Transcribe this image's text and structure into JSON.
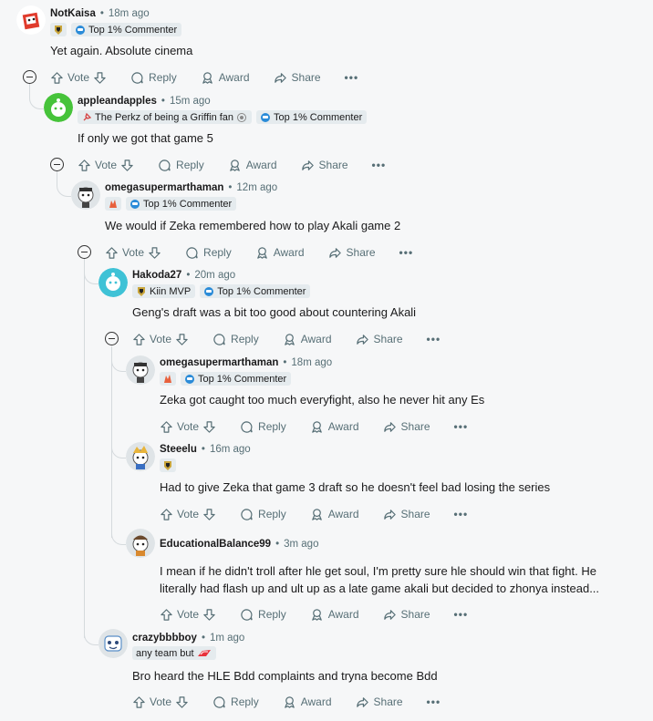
{
  "actions": {
    "vote": "Vote",
    "reply": "Reply",
    "award": "Award",
    "share": "Share",
    "more": "•••"
  },
  "comments": [
    {
      "username": "NotKaisa",
      "time": "18m ago",
      "flairs": [
        {
          "icon": "team-crest-icon",
          "text": ""
        },
        {
          "icon": "commenter-badge-icon",
          "text": "Top 1% Commenter"
        }
      ],
      "body": "Yet again. Absolute cinema",
      "avatar_color": "#e03b2c"
    },
    {
      "username": "appleandapples",
      "time": "15m ago",
      "flairs": [
        {
          "icon": "pin-icon",
          "text": "The Perkz of being a Griffin fan"
        },
        {
          "icon": "lion-crest-icon",
          "text": ""
        },
        {
          "icon": "commenter-badge-icon",
          "text": "Top 1% Commenter"
        }
      ],
      "body": "If only we got that game 5",
      "avatar_color": "#46c33a"
    },
    {
      "username": "omegasupermarthaman",
      "time": "12m ago",
      "flairs": [
        {
          "icon": "flame-crest-icon",
          "text": ""
        },
        {
          "icon": "commenter-badge-icon",
          "text": "Top 1% Commenter"
        }
      ],
      "body": "We would if Zeka remembered how to play Akali game 2",
      "avatar_color": "#cfd6da"
    },
    {
      "username": "Hakoda27",
      "time": "20m ago",
      "flairs": [
        {
          "icon": "team-crest-icon",
          "text": "Kiin MVP"
        },
        {
          "icon": "commenter-badge-icon",
          "text": "Top 1% Commenter"
        }
      ],
      "body": "Geng's draft was a bit too good about countering Akali",
      "avatar_color": "#3fc2d6"
    },
    {
      "username": "omegasupermarthaman",
      "time": "18m ago",
      "flairs": [
        {
          "icon": "flame-crest-icon",
          "text": ""
        },
        {
          "icon": "commenter-badge-icon",
          "text": "Top 1% Commenter"
        }
      ],
      "body": "Zeka got caught too much everyfight, also he never hit any Es",
      "avatar_color": "#cfd6da"
    },
    {
      "username": "Steeelu",
      "time": "16m ago",
      "flairs": [
        {
          "icon": "team-crest-icon",
          "text": ""
        }
      ],
      "body": "Had to give Zeka that game 3 draft so he doesn't feel bad losing the series",
      "avatar_color": "#cfd6da"
    },
    {
      "username": "EducationalBalance99",
      "time": "3m ago",
      "flairs": [],
      "body_lines": [
        "I mean if he didn't troll after hle get soul, I'm pretty sure hle should win that fight. He",
        "literally had flash up and ult up as a late game akali but decided to zhonya instead..."
      ],
      "avatar_color": "#cfd6da"
    },
    {
      "username": "crazybbbboy",
      "time": "1m ago",
      "flairs": [
        {
          "icon": "",
          "text": "any team but"
        }
      ],
      "body": "Bro heard the HLE Bdd complaints and tryna become Bdd",
      "avatar_color": "#cfd6da"
    }
  ]
}
